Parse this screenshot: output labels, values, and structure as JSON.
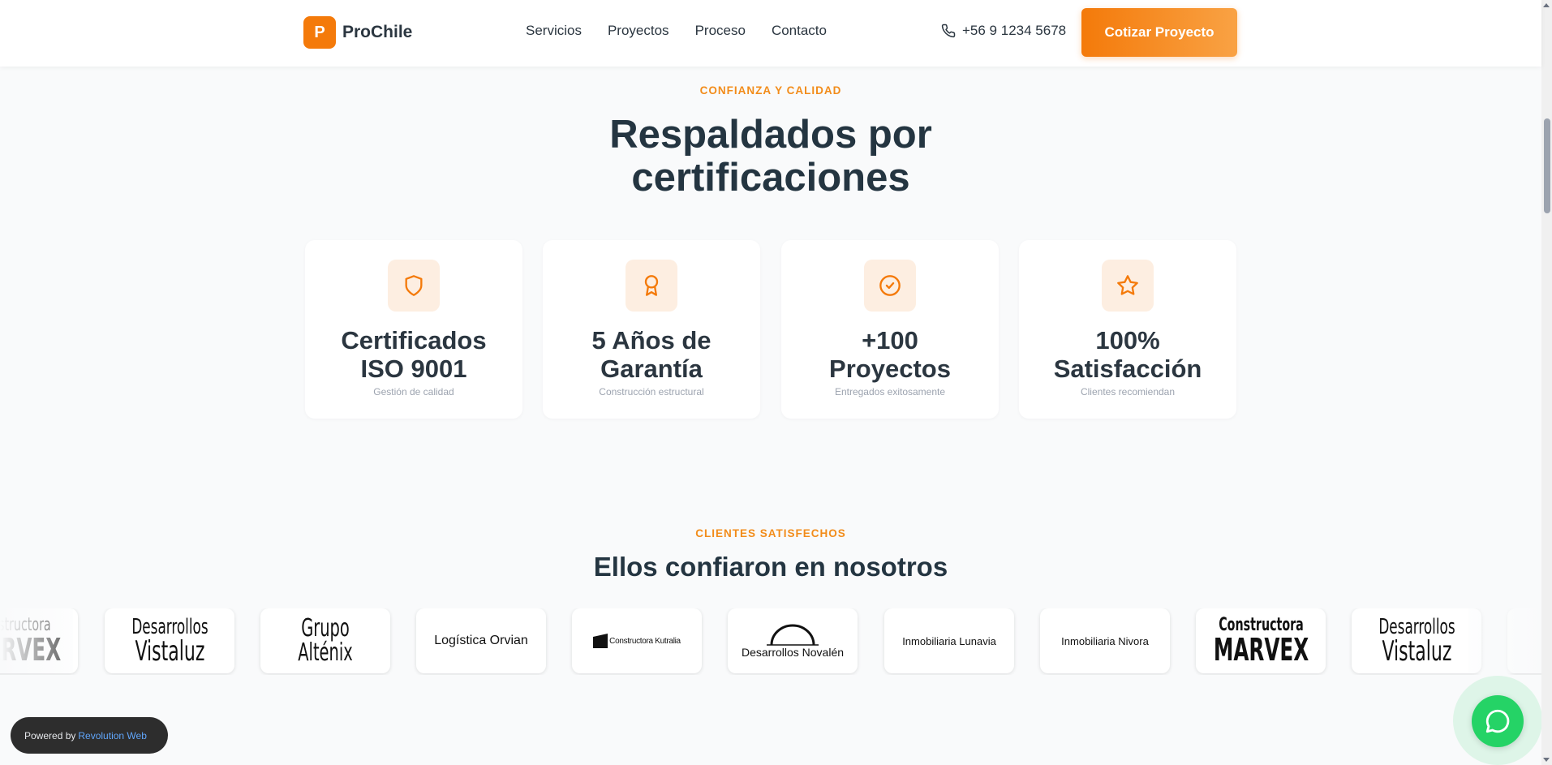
{
  "header": {
    "logo_letter": "P",
    "logo_text": "ProChile",
    "nav": [
      "Servicios",
      "Proyectos",
      "Proceso",
      "Contacto"
    ],
    "phone": "+56 9 1234 5678",
    "cta": "Cotizar Proyecto"
  },
  "trust": {
    "eyebrow": "CONFIANZA Y CALIDAD",
    "title_line1": "Respaldados por",
    "title_line2": "certificaciones",
    "cards": [
      {
        "icon": "shield-icon",
        "line1": "Certificados",
        "line2": "ISO 9001",
        "sub": "Gestión de calidad"
      },
      {
        "icon": "award-icon",
        "line1": "5 Años de",
        "line2": "Garantía",
        "sub": "Construcción estructural"
      },
      {
        "icon": "check-circle-icon",
        "line1": "+100",
        "line2": "Proyectos",
        "sub": "Entregados exitosamente"
      },
      {
        "icon": "star-icon",
        "line1": "100%",
        "line2": "Satisfacción",
        "sub": "Clientes recomiendan"
      }
    ]
  },
  "clients": {
    "eyebrow": "CLIENTES SATISFECHOS",
    "title": "Ellos confiaron en nosotros",
    "logos": [
      {
        "line1": "Constructora",
        "line2": "MARVEX"
      },
      {
        "line1": "Desarrollos",
        "line2": "Vistaluz"
      },
      {
        "line1": "Grupo Alténix"
      },
      {
        "line1": "Logística Orvian"
      },
      {
        "line1": "Constructora Kutralia"
      },
      {
        "line1": "Desarrollos Novalén"
      },
      {
        "line1": "Inmobiliaria Lunavia"
      },
      {
        "line1": "Inmobiliaria Nivora"
      },
      {
        "line1": "Constructora",
        "line2": "MARVEX"
      },
      {
        "line1": "Desarrollos",
        "line2": "Vistaluz"
      }
    ]
  },
  "powered": {
    "prefix": "Powered by",
    "brand": "Revolution Web"
  },
  "colors": {
    "accent": "#f47a0a",
    "heading": "#243541",
    "whatsapp": "#25d366"
  }
}
